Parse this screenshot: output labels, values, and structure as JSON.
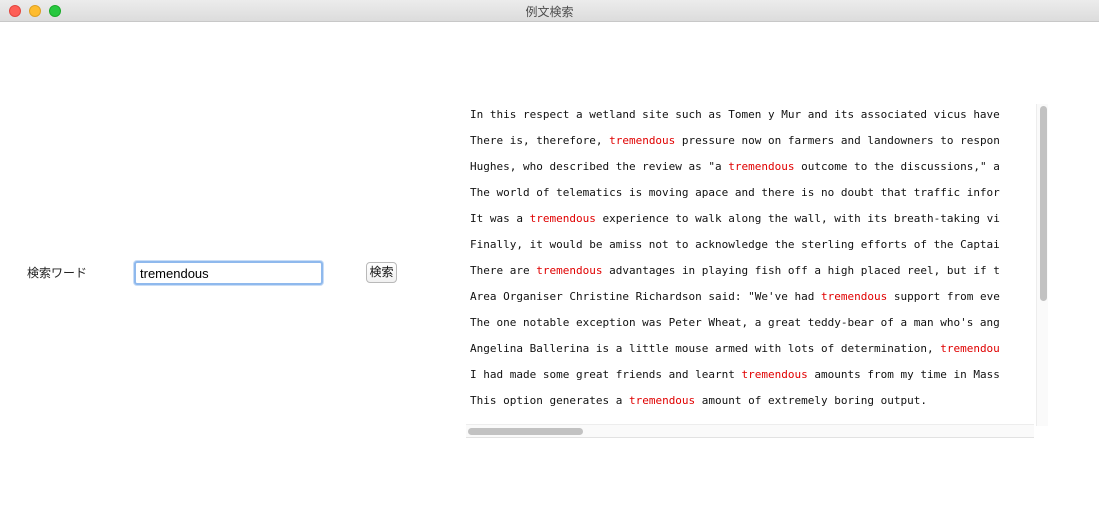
{
  "window": {
    "title": "例文検索"
  },
  "search": {
    "label": "検索ワード",
    "value": "tremendous",
    "button_label": "検索"
  },
  "results": [
    {
      "before": "In this respect a wetland site such as Tomen y Mur and its associated vicus have",
      "match": "",
      "after": ""
    },
    {
      "before": "There is, therefore, ",
      "match": "tremendous",
      "after": " pressure now on farmers and landowners to respon"
    },
    {
      "before": "Hughes, who described the review as \"a ",
      "match": "tremendous",
      "after": " outcome to the discussions,\" a"
    },
    {
      "before": "The world of telematics is moving apace and there is no doubt that traffic infor",
      "match": "",
      "after": ""
    },
    {
      "before": "It was a ",
      "match": "tremendous",
      "after": " experience to walk along the wall, with its breath-taking vi"
    },
    {
      "before": "Finally, it would be amiss not to acknowledge the sterling efforts of the Captai",
      "match": "",
      "after": ""
    },
    {
      "before": "There are ",
      "match": "tremendous",
      "after": " advantages in playing fish off a high placed reel, but if t"
    },
    {
      "before": "Area Organiser Christine Richardson said: \"We've had ",
      "match": "tremendous",
      "after": " support from eve"
    },
    {
      "before": "The one notable exception was Peter Wheat, a great teddy-bear of a man who's ang",
      "match": "",
      "after": ""
    },
    {
      "before": "Angelina Ballerina is a little mouse armed with lots of determination, ",
      "match": "tremendou",
      "after": ""
    },
    {
      "before": "I had made some great friends and learnt ",
      "match": "tremendous",
      "after": " amounts from my time in Mass"
    },
    {
      "before": "This option generates a ",
      "match": "tremendous",
      "after": " amount of extremely boring output."
    }
  ],
  "colors": {
    "highlight": "#e00000",
    "focus_ring": "#8fb9ed"
  }
}
